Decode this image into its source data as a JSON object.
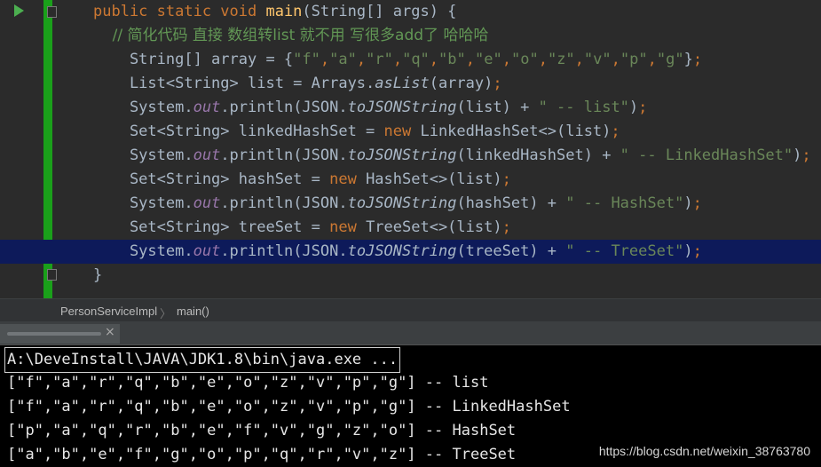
{
  "editor": {
    "lines": [
      {
        "parts": [
          {
            "t": "public static void ",
            "c": "kw"
          },
          {
            "t": "main",
            "c": "fn"
          },
          {
            "t": "(String[] args) {",
            "c": "pn"
          }
        ]
      },
      {
        "parts": [
          {
            "t": "    // 简化代码 直接 数组转list 就不用 写很多add了 哈哈哈",
            "c": "cm"
          }
        ]
      },
      {
        "parts": [
          {
            "t": "    String[] array = {",
            "c": "pn"
          },
          {
            "t": "\"f\"",
            "c": "str"
          },
          {
            "t": ",",
            "c": "kw"
          },
          {
            "t": "\"a\"",
            "c": "str"
          },
          {
            "t": ",",
            "c": "kw"
          },
          {
            "t": "\"r\"",
            "c": "str"
          },
          {
            "t": ",",
            "c": "kw"
          },
          {
            "t": "\"q\"",
            "c": "str"
          },
          {
            "t": ",",
            "c": "kw"
          },
          {
            "t": "\"b\"",
            "c": "str"
          },
          {
            "t": ",",
            "c": "kw"
          },
          {
            "t": "\"e\"",
            "c": "str"
          },
          {
            "t": ",",
            "c": "kw"
          },
          {
            "t": "\"o\"",
            "c": "str"
          },
          {
            "t": ",",
            "c": "kw"
          },
          {
            "t": "\"z\"",
            "c": "str"
          },
          {
            "t": ",",
            "c": "kw"
          },
          {
            "t": "\"v\"",
            "c": "str"
          },
          {
            "t": ",",
            "c": "kw"
          },
          {
            "t": "\"p\"",
            "c": "str"
          },
          {
            "t": ",",
            "c": "kw"
          },
          {
            "t": "\"g\"",
            "c": "str"
          },
          {
            "t": "}",
            "c": "pn"
          },
          {
            "t": ";",
            "c": "kw"
          }
        ]
      },
      {
        "parts": [
          {
            "t": "    List<String> list = Arrays.",
            "c": "pn"
          },
          {
            "t": "asList",
            "c": "it"
          },
          {
            "t": "(array)",
            "c": "pn"
          },
          {
            "t": ";",
            "c": "kw"
          }
        ]
      },
      {
        "parts": [
          {
            "t": "    System.",
            "c": "pn"
          },
          {
            "t": "out",
            "c": "fld"
          },
          {
            "t": ".println(JSON.",
            "c": "pn"
          },
          {
            "t": "toJSONString",
            "c": "it"
          },
          {
            "t": "(list) + ",
            "c": "pn"
          },
          {
            "t": "\" -- list\"",
            "c": "str"
          },
          {
            "t": ")",
            "c": "pn"
          },
          {
            "t": ";",
            "c": "kw"
          }
        ]
      },
      {
        "parts": [
          {
            "t": "    Set<String> linkedHashSet = ",
            "c": "pn"
          },
          {
            "t": "new ",
            "c": "kw"
          },
          {
            "t": "LinkedHashSet<>(list)",
            "c": "pn"
          },
          {
            "t": ";",
            "c": "kw"
          }
        ]
      },
      {
        "parts": [
          {
            "t": "    System.",
            "c": "pn"
          },
          {
            "t": "out",
            "c": "fld"
          },
          {
            "t": ".println(JSON.",
            "c": "pn"
          },
          {
            "t": "toJSONString",
            "c": "it"
          },
          {
            "t": "(linkedHashSet) + ",
            "c": "pn"
          },
          {
            "t": "\" -- LinkedHashSet\"",
            "c": "str"
          },
          {
            "t": ")",
            "c": "pn"
          },
          {
            "t": ";",
            "c": "kw"
          }
        ]
      },
      {
        "parts": [
          {
            "t": "    Set<String> hashSet = ",
            "c": "pn"
          },
          {
            "t": "new ",
            "c": "kw"
          },
          {
            "t": "HashSet<>(list)",
            "c": "pn"
          },
          {
            "t": ";",
            "c": "kw"
          }
        ]
      },
      {
        "parts": [
          {
            "t": "    System.",
            "c": "pn"
          },
          {
            "t": "out",
            "c": "fld"
          },
          {
            "t": ".println(JSON.",
            "c": "pn"
          },
          {
            "t": "toJSONString",
            "c": "it"
          },
          {
            "t": "(hashSet) + ",
            "c": "pn"
          },
          {
            "t": "\" -- HashSet\"",
            "c": "str"
          },
          {
            "t": ")",
            "c": "pn"
          },
          {
            "t": ";",
            "c": "kw"
          }
        ]
      },
      {
        "parts": [
          {
            "t": "    Set<String> treeSet = ",
            "c": "pn"
          },
          {
            "t": "new ",
            "c": "kw"
          },
          {
            "t": "TreeSet<>(list)",
            "c": "pn"
          },
          {
            "t": ";",
            "c": "kw"
          }
        ]
      },
      {
        "parts": [
          {
            "t": "    System.",
            "c": "pn"
          },
          {
            "t": "out",
            "c": "fld"
          },
          {
            "t": ".println(JSON.",
            "c": "pn"
          },
          {
            "t": "toJSONString",
            "c": "it"
          },
          {
            "t": "(treeSet) + ",
            "c": "pn"
          },
          {
            "t": "\" -- TreeSet\"",
            "c": "str"
          },
          {
            "t": ")",
            "c": "pn"
          },
          {
            "t": ";",
            "c": "kw"
          }
        ]
      },
      {
        "parts": [
          {
            "t": "}",
            "c": "pn"
          }
        ]
      }
    ],
    "highlighted_line": 10,
    "run_icon": "run-arrow-icon"
  },
  "breadcrumb": {
    "class_name": "PersonServiceImpl",
    "separator": "〉",
    "method_name": "main()"
  },
  "run_tab": {
    "close_icon": "×"
  },
  "console": {
    "command": "A:\\DeveInstall\\JAVA\\JDK1.8\\bin\\java.exe ...",
    "output": [
      "[\"f\",\"a\",\"r\",\"q\",\"b\",\"e\",\"o\",\"z\",\"v\",\"p\",\"g\"] -- list",
      "[\"f\",\"a\",\"r\",\"q\",\"b\",\"e\",\"o\",\"z\",\"v\",\"p\",\"g\"] -- LinkedHashSet",
      "[\"p\",\"a\",\"q\",\"r\",\"b\",\"e\",\"f\",\"v\",\"g\",\"z\",\"o\"] -- HashSet",
      "[\"a\",\"b\",\"e\",\"f\",\"g\",\"o\",\"p\",\"q\",\"r\",\"v\",\"z\"] -- TreeSet"
    ]
  },
  "watermark": "https://blog.csdn.net/weixin_38763780",
  "colors": {
    "background": "#2b2b2b",
    "keyword": "#cc7832",
    "string": "#6a8759",
    "method": "#ffc66d",
    "field": "#9876aa",
    "highlight": "#0d1a5a",
    "gutter_change": "#1aa01a"
  }
}
